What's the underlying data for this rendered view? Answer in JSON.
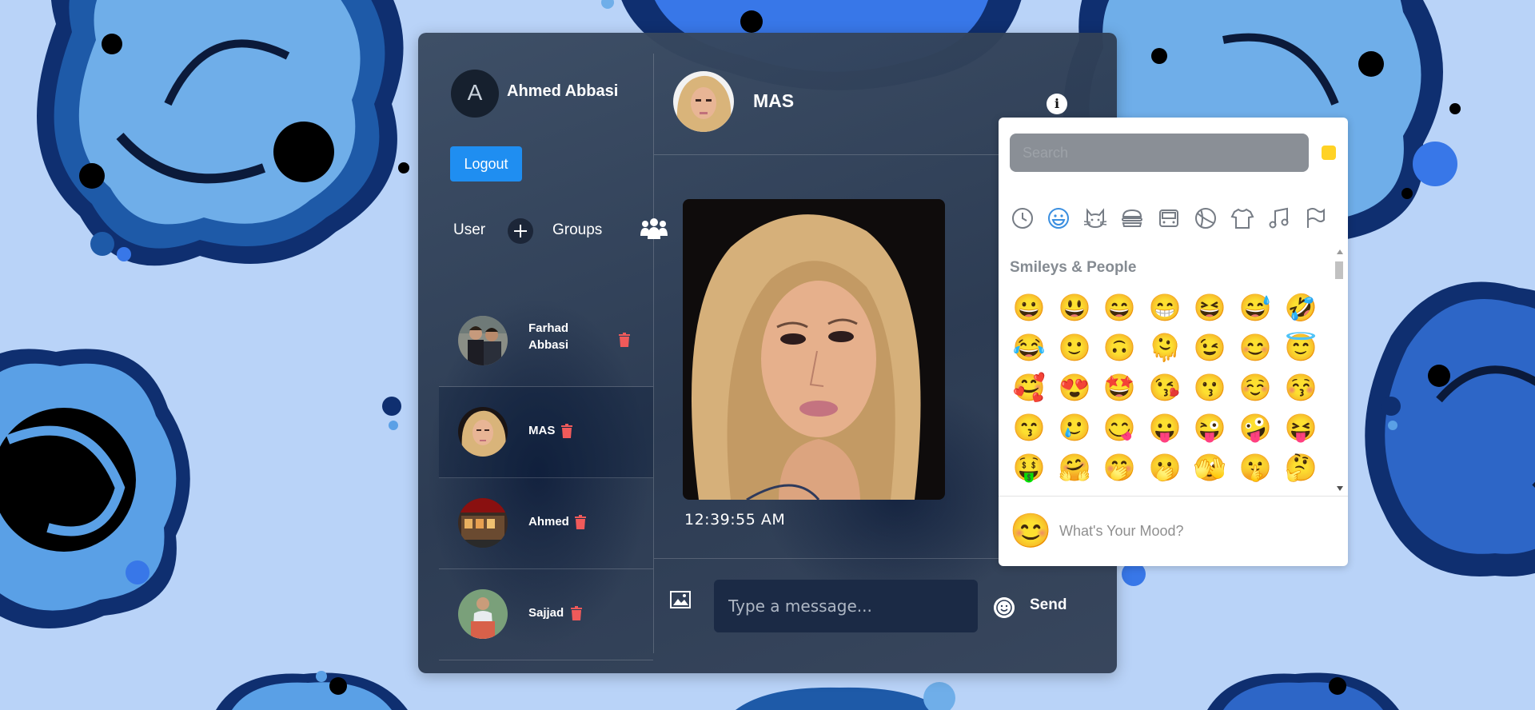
{
  "user": {
    "avatar_letter": "A",
    "name": "Ahmed Abbasi",
    "logout_label": "Logout"
  },
  "tabs": {
    "user": "User",
    "groups": "Groups"
  },
  "contacts": [
    {
      "name_line1": "Farhad",
      "name_line2": "Abbasi"
    },
    {
      "name_line1": "MAS",
      "name_line2": ""
    },
    {
      "name_line1": "Ahmed",
      "name_line2": ""
    },
    {
      "name_line1": "Sajjad",
      "name_line2": ""
    }
  ],
  "chat": {
    "name": "MAS",
    "message_time": "12:39:55 AM"
  },
  "composer": {
    "placeholder": "Type a message...",
    "send_label": "Send"
  },
  "emoji_picker": {
    "search_placeholder": "Search",
    "category_title": "Smileys & People",
    "categories": [
      "recent-icon",
      "smileys-icon",
      "animals-icon",
      "food-icon",
      "travel-icon",
      "activity-icon",
      "objects-icon",
      "symbols-icon",
      "flags-icon"
    ],
    "emojis": [
      "😀",
      "😃",
      "😄",
      "😁",
      "😆",
      "😅",
      "🤣",
      "😂",
      "🙂",
      "🙃",
      "🫠",
      "😉",
      "😊",
      "😇",
      "🥰",
      "😍",
      "🤩",
      "😘",
      "😗",
      "☺️",
      "😚",
      "😙",
      "🥲",
      "😋",
      "😛",
      "😜",
      "🤪",
      "😝",
      "🤑",
      "🤗",
      "🤭",
      "🫢",
      "🫣",
      "🤫",
      "🤔"
    ],
    "footer_emoji": "😊",
    "footer_text": "What's Your Mood?"
  },
  "colors": {
    "accent": "#1f8ef1",
    "trash": "#f05a5a",
    "card": "#2e3d55"
  }
}
